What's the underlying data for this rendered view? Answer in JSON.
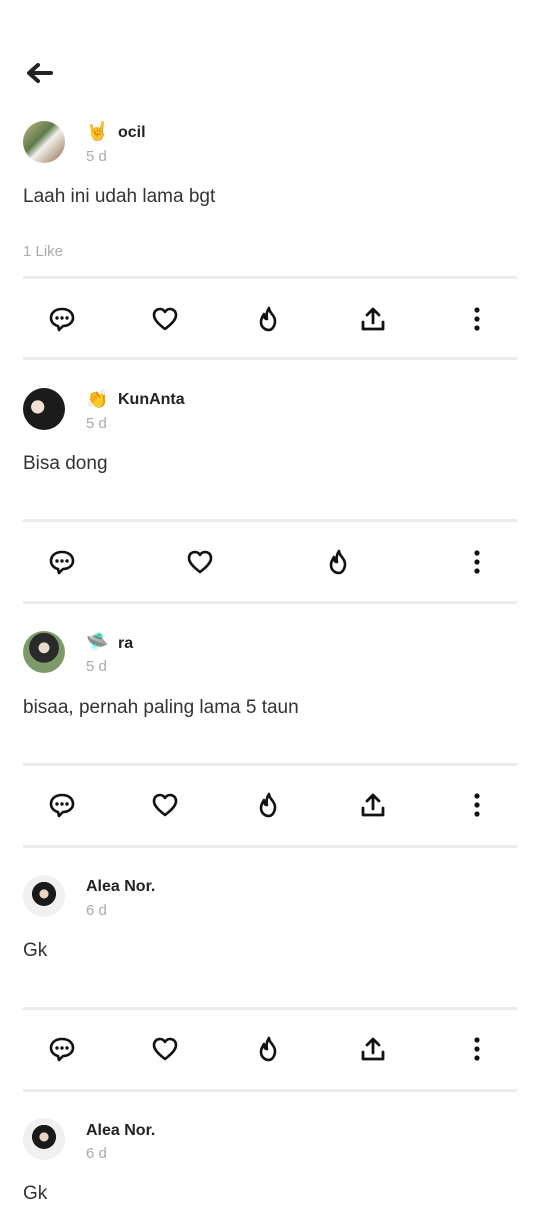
{
  "header": {
    "back_icon": "arrow-left-icon"
  },
  "posts": [
    {
      "user": "ocil",
      "emoji": "🤘",
      "time": "5 d",
      "text": "Laah ini udah lama bgt",
      "likes": "1 Like"
    },
    {
      "user": "KunAnta",
      "emoji": "👏",
      "time": "5 d",
      "text": "Bisa dong"
    },
    {
      "user": "ra",
      "emoji": "🛸",
      "time": "5 d",
      "text": "bisaa, pernah paling lama 5 taun"
    },
    {
      "user": "Alea Nor.",
      "time": "6 d",
      "text": "Gk"
    },
    {
      "user": "Alea Nor.",
      "time": "6 d",
      "text": "Gk"
    }
  ],
  "actions": [
    "comment-icon",
    "heart-icon",
    "fire-icon",
    "share-icon",
    "more-vertical-icon"
  ]
}
